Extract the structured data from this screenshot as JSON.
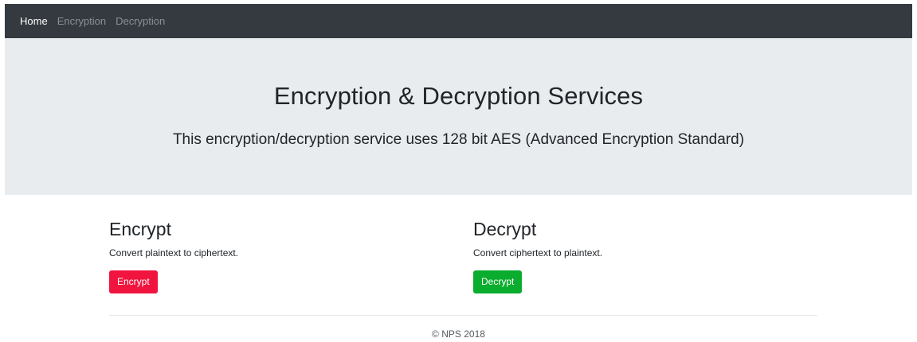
{
  "navbar": {
    "items": [
      {
        "label": "Home",
        "active": true
      },
      {
        "label": "Encryption",
        "active": false
      },
      {
        "label": "Decryption",
        "active": false
      }
    ]
  },
  "jumbotron": {
    "title": "Encryption & Decryption Services",
    "lead": "This encryption/decryption service uses 128 bit AES (Advanced Encryption Standard)"
  },
  "encrypt": {
    "heading": "Encrypt",
    "description": "Convert plaintext to ciphertext.",
    "button_label": "Encrypt"
  },
  "decrypt": {
    "heading": "Decrypt",
    "description": "Convert ciphertext to plaintext.",
    "button_label": "Decrypt"
  },
  "footer": {
    "text": "© NPS 2018"
  },
  "colors": {
    "navbar_bg": "#343a40",
    "jumbotron_bg": "#e9ecef",
    "encrypt_button": "#f0143f",
    "decrypt_button": "#0aad2e"
  }
}
